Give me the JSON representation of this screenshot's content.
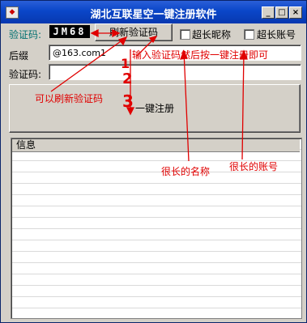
{
  "window": {
    "title": "湖北互联星空一键注册软件",
    "min_glyph": "_",
    "max_glyph": "□",
    "close_glyph": "×",
    "icon_glyph": "◆"
  },
  "form": {
    "captcha_label": "验证码:",
    "captcha_value": "JM68",
    "refresh_button": "刷新验证码",
    "long_nick_label": "超长昵称",
    "long_account_label": "超长账号",
    "suffix_label": "后缀",
    "suffix_value": "@163.com1",
    "captcha_input_label": "验证码:",
    "captcha_input_value": "",
    "register_button": "一键注册"
  },
  "log": {
    "header": "信息"
  },
  "annotations": {
    "instruction": "输入验证码然后按一键注册即可",
    "refresh_hint": "可以刷新验证码",
    "long_name_hint": "很长的名称",
    "long_account_hint": "很长的账号",
    "step1": "1",
    "step2": "2",
    "step3": "3",
    "color": "#e00000"
  }
}
